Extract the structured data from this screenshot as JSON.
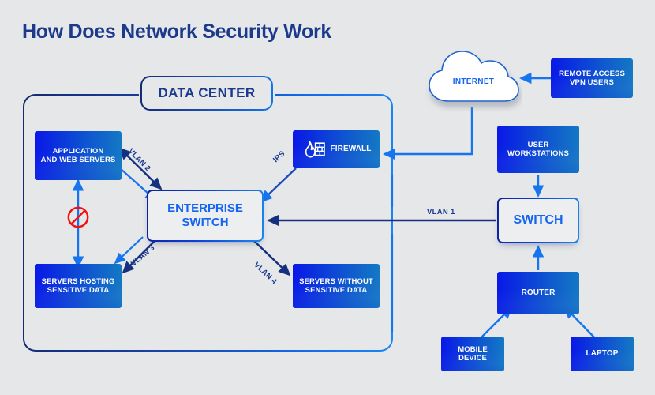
{
  "page": {
    "title": "How Does Network Security Work",
    "background_color": "#e6e7e9",
    "title_color": "#1b3a8c",
    "accent_color": "#1565f0"
  },
  "data_center": {
    "label": "DATA CENTER"
  },
  "nodes": {
    "app_web_servers": {
      "line1": "APPLICATION",
      "line2": "AND WEB SERVERS"
    },
    "enterprise_switch": {
      "line1": "ENTERPRISE",
      "line2": "SWITCH"
    },
    "firewall": {
      "label": "FIREWALL",
      "icon": "firewall-flame-brick-icon"
    },
    "servers_sensitive": {
      "line1": "SERVERS HOSTING",
      "line2": "SENSITIVE DATA"
    },
    "servers_without_sensitive": {
      "line1": "SERVERS WITHOUT",
      "line2": "SENSITIVE DATA"
    },
    "internet": {
      "label": "INTERNET",
      "icon": "cloud-icon"
    },
    "remote_vpn": {
      "line1": "REMOTE ACCESS",
      "line2": "VPN USERS"
    },
    "user_workstations": {
      "line1": "USER",
      "line2": "WORKSTATIONS"
    },
    "switch": {
      "label": "SWITCH"
    },
    "router": {
      "label": "ROUTER"
    },
    "mobile_device": {
      "line1": "MOBILE",
      "line2": "DEVICE"
    },
    "laptop": {
      "label": "LAPTOP"
    }
  },
  "connection_labels": {
    "vlan1": "VLAN 1",
    "vlan2": "VLAN 2",
    "vlan3": "VLAN 3",
    "vlan4": "VLAN 4",
    "ips": "IPS"
  },
  "markers": {
    "blocked": "no-entry-blocked-icon"
  }
}
